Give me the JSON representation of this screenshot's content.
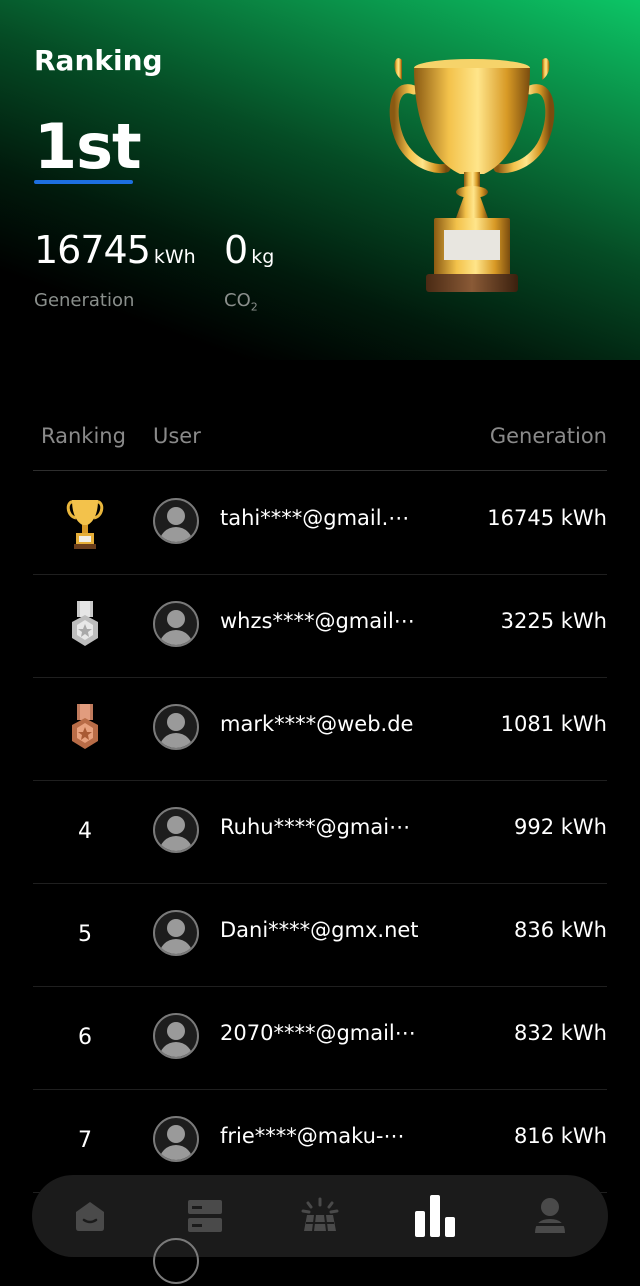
{
  "header": {
    "title": "Ranking",
    "rank": "1st",
    "generation_value": "16745",
    "generation_unit": "kWh",
    "generation_label": "Generation",
    "co2_value": "0",
    "co2_unit": "kg",
    "co2_label": "CO",
    "co2_label_sub": "2"
  },
  "table": {
    "col_ranking": "Ranking",
    "col_user": "User",
    "col_generation": "Generation",
    "rows": [
      {
        "rank": "",
        "medal": "gold",
        "email": "tahi****@gmail.⋯",
        "generation": "16745 kWh"
      },
      {
        "rank": "",
        "medal": "silver",
        "email": "whzs****@gmail⋯",
        "generation": "3225 kWh"
      },
      {
        "rank": "",
        "medal": "bronze",
        "email": "mark****@web.de",
        "generation": "1081 kWh"
      },
      {
        "rank": "4",
        "email": "Ruhu****@gmai⋯",
        "generation": "992 kWh"
      },
      {
        "rank": "5",
        "email": "Dani****@gmx.net",
        "generation": "836 kWh"
      },
      {
        "rank": "6",
        "email": "2070****@gmail⋯",
        "generation": "832 kWh"
      },
      {
        "rank": "7",
        "email": "frie****@maku-⋯",
        "generation": "816 kWh"
      }
    ]
  },
  "nav": {
    "items": [
      {
        "icon": "home-icon",
        "active": false
      },
      {
        "icon": "devices-icon",
        "active": false
      },
      {
        "icon": "solar-panel-icon",
        "active": false
      },
      {
        "icon": "ranking-bar-chart-icon",
        "active": true
      },
      {
        "icon": "profile-icon",
        "active": false
      }
    ]
  },
  "colors": {
    "accent_green": "#0cc566",
    "underline_blue": "#1d6fe0",
    "background": "#000000",
    "nav_background": "#1b1b1b"
  }
}
